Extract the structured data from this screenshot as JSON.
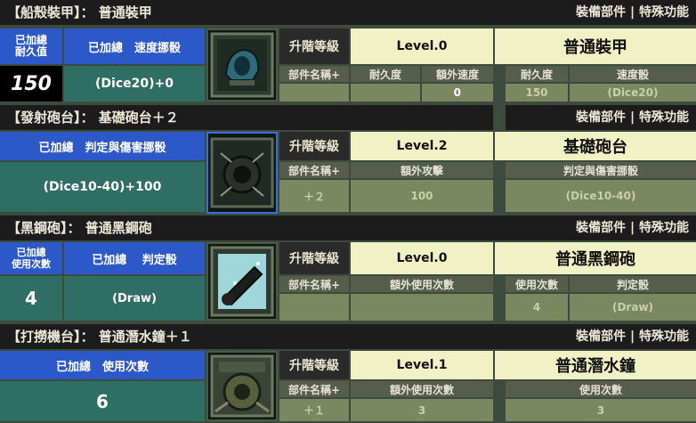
{
  "header_right": "裝備部件 | 特殊功能",
  "sections": [
    {
      "title": "【船殼裝甲】： 普通裝甲",
      "left_label_a": "已加總\n耐久值",
      "left_label_b": "已加總　速度挪骰",
      "left_value_a": "150",
      "left_value_b": "(Dice20)+0",
      "icon": "hull-armor-icon",
      "upgrade_label": "升階等級",
      "level": "Level.0",
      "part_name": "普通裝甲",
      "sub_headers": [
        "部件名稱+",
        "耐久度",
        "額外速度"
      ],
      "sub_values": [
        "",
        "",
        "0"
      ],
      "right_headers": [
        "耐久度",
        "速度骰"
      ],
      "right_values": [
        "150",
        "(Dice20)"
      ]
    },
    {
      "title": "【發射砲台】： 基礎砲台＋２",
      "left_label": "已加總　判定與傷害挪骰",
      "left_value": "(Dice10-40)+100",
      "icon": "cannon-turret-icon",
      "upgrade_label": "升階等級",
      "level": "Level.2",
      "part_name": "基礎砲台",
      "sub_headers": [
        "部件名稱+",
        "額外攻擊"
      ],
      "sub_values": [
        "＋２",
        "100"
      ],
      "right_headers": [
        "判定與傷害挪骰"
      ],
      "right_values": [
        "(Dice10-40)"
      ]
    },
    {
      "title": "【黑鋼砲】： 普通黑鋼砲",
      "left_label_a": "已加總\n使用次數",
      "left_label_b": "已加總　 判定骰",
      "left_value_a": "4",
      "left_value_b": "(Draw)",
      "icon": "black-steel-cannon-icon",
      "upgrade_label": "升階等級",
      "level": "Level.0",
      "part_name": "普通黑鋼砲",
      "sub_headers": [
        "部件名稱+",
        "額外使用次數"
      ],
      "sub_values": [
        "",
        ""
      ],
      "right_headers": [
        "使用次數",
        "判定骰"
      ],
      "right_values": [
        "4",
        "(Draw)"
      ]
    },
    {
      "title": "【打撈機台】： 普通潛水鐘＋１",
      "left_label": "已加總　使用次數",
      "left_value": "6",
      "icon": "diving-bell-icon",
      "upgrade_label": "升階等級",
      "level": "Level.1",
      "part_name": "普通潛水鐘",
      "sub_headers": [
        "部件名稱+",
        "額外使用次數"
      ],
      "sub_values": [
        "＋１",
        "3"
      ],
      "right_headers": [
        "使用次數"
      ],
      "right_values": [
        "3"
      ]
    }
  ]
}
